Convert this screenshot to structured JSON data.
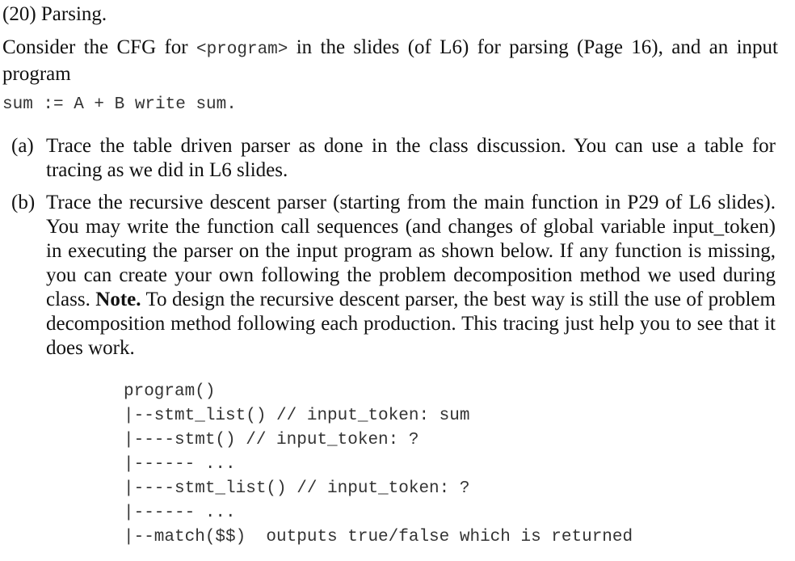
{
  "heading": "(20) Parsing.",
  "intro": {
    "before_code": "Consider the CFG for ",
    "code": "<program>",
    "after_code": " in the slides (of L6) for parsing (Page 16), and an input program"
  },
  "input_program": "sum := A + B write sum.",
  "items": [
    {
      "label": "(a)",
      "text": "Trace the table driven parser as done in the class discussion.  You can use a table for tracing as we did in L6 slides."
    },
    {
      "label": "(b)",
      "text_before_note": "Trace the recursive descent parser (starting from the main function in P29 of L6 slides). You may write the function call sequences (and changes of global variable input_token) in executing the parser on the input program as shown below. If any function is missing, you can create your own following the problem decomposition method we used during class. ",
      "note_label": "Note.",
      "text_after_note": " To design the recursive descent parser, the best way is still the use of problem decomposition method following each production. This tracing just help you to see that it does work."
    }
  ],
  "trace_lines": [
    "program()",
    "|--stmt_list() // input_token: sum",
    "|----stmt() // input_token: ?",
    "|------ ...",
    "|----stmt_list() // input_token: ?",
    "|------ ...",
    "|--match($$)  outputs true/false which is returned"
  ]
}
